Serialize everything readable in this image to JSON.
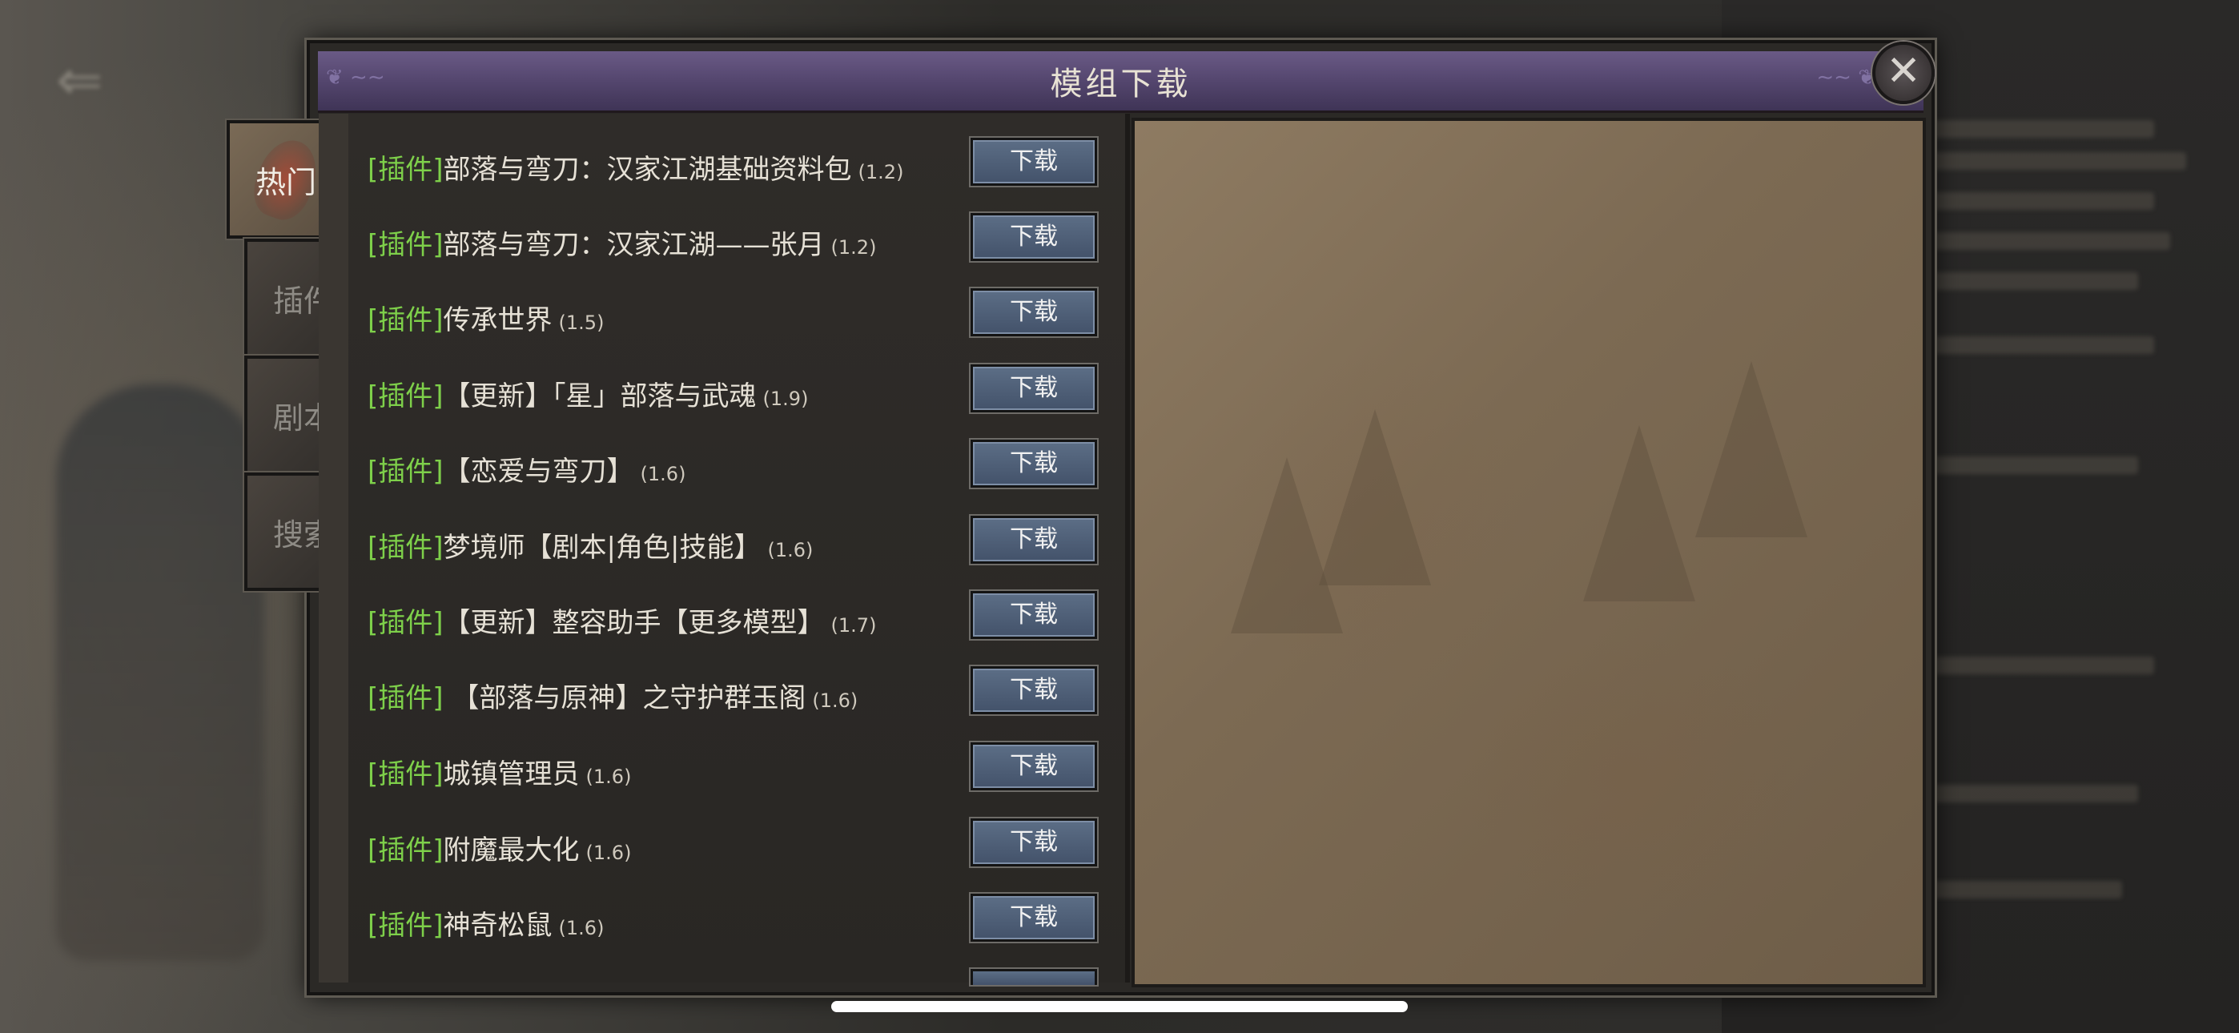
{
  "dialog": {
    "title": "模组下载",
    "close_icon": "✕"
  },
  "tabs": [
    {
      "label": "热门",
      "active": true
    },
    {
      "label": "插件",
      "active": false
    },
    {
      "label": "剧本",
      "active": false
    },
    {
      "label": "搜索",
      "active": false
    }
  ],
  "download_label": "下载",
  "mods": [
    {
      "tag": "[插件]",
      "name": "部落与弯刀：汉家江湖基础资料包",
      "version": "(1.2)"
    },
    {
      "tag": "[插件]",
      "name": "部落与弯刀：汉家江湖——张月",
      "version": "(1.2)"
    },
    {
      "tag": "[插件]",
      "name": "传承世界",
      "version": "(1.5)"
    },
    {
      "tag": "[插件]",
      "name": "【更新】「星」部落与武魂",
      "version": "(1.9)"
    },
    {
      "tag": "[插件]",
      "name": "【恋爱与弯刀】",
      "version": "(1.6)"
    },
    {
      "tag": "[插件]",
      "name": "梦境师【剧本|角色|技能】",
      "version": "(1.6)"
    },
    {
      "tag": "[插件]",
      "name": "【更新】整容助手【更多模型】",
      "version": "(1.7)"
    },
    {
      "tag": "[插件]",
      "name": " 【部落与原神】之守护群玉阁",
      "version": "(1.6)"
    },
    {
      "tag": "[插件]",
      "name": "城镇管理员",
      "version": "(1.6)"
    },
    {
      "tag": "[插件]",
      "name": "附魔最大化",
      "version": "(1.6)"
    },
    {
      "tag": "[插件]",
      "name": "神奇松鼠",
      "version": "(1.6)"
    }
  ],
  "colors": {
    "tag_green": "#7ed04a",
    "title_purple": "#54466e",
    "button_blue": "#4f5f78"
  }
}
